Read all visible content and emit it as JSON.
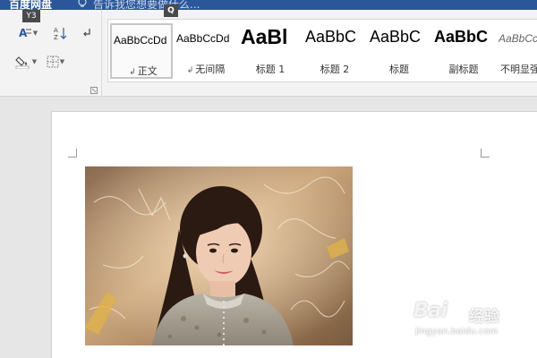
{
  "titlebar": {
    "tab_label": "百度网盘",
    "tell_me": "告诉我您想要做什么..."
  },
  "keytips": {
    "y3": "Y3",
    "q": "Q"
  },
  "ribbon": {
    "paragraph_icons": [
      "text-effects-icon",
      "sort-icon",
      "show-marks-icon",
      "shading-icon",
      "borders-icon",
      "dialog-launcher-icon"
    ],
    "styles": [
      {
        "preview": "AaBbCcDd",
        "label": "正文",
        "has_mark": true,
        "selected": true
      },
      {
        "preview": "AaBbCcDd",
        "label": "无间隔",
        "has_mark": true,
        "selected": false
      },
      {
        "preview": "AaBl",
        "label": "标题 1",
        "has_mark": false,
        "selected": false
      },
      {
        "preview": "AaBbC",
        "label": "标题 2",
        "has_mark": false,
        "selected": false
      },
      {
        "preview": "AaBbC",
        "label": "标题",
        "has_mark": false,
        "selected": false
      },
      {
        "preview": "AaBbC",
        "label": "副标题",
        "has_mark": false,
        "selected": false
      },
      {
        "preview": "AaBbCcDd",
        "label": "不明显强调",
        "has_mark": false,
        "selected": false
      }
    ],
    "paragraph_mark": "↲"
  },
  "document": {
    "image_description_icon": "portrait-photo",
    "watermark": {
      "logo": "Bai",
      "name": "经验",
      "url": "jingyan.baidu.com"
    }
  },
  "colors": {
    "titlebar": "#2b579a",
    "ribbon": "#f3f3f3",
    "canvas": "#e6e6e6",
    "page": "#ffffff"
  }
}
